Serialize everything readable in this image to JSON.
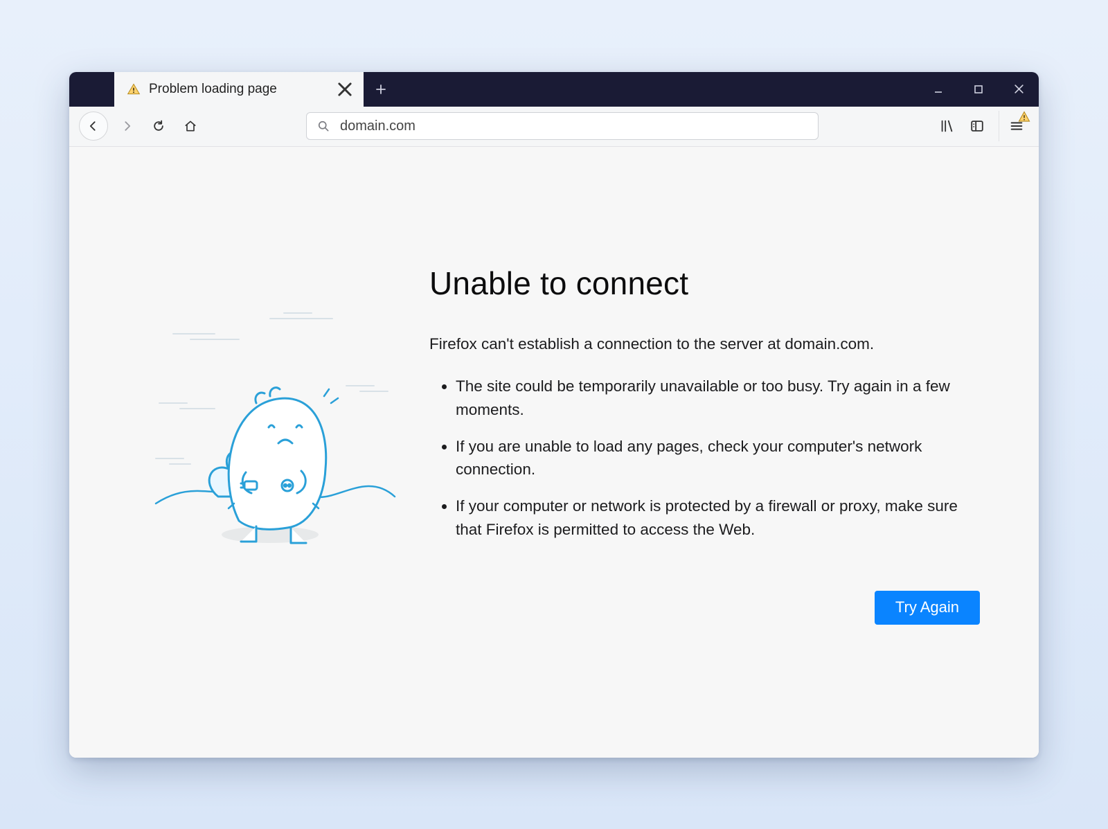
{
  "tab": {
    "title": "Problem loading page",
    "favicon": "warning-triangle-icon"
  },
  "addressBar": {
    "value": "domain.com",
    "searchIcon": "search-icon"
  },
  "nav": {
    "back": "back-icon",
    "forward": "forward-icon",
    "reload": "reload-icon",
    "home": "home-icon"
  },
  "toolbarRight": {
    "library": "library-icon",
    "sidebars": "sidebars-icon",
    "menu": "hamburger-icon",
    "menuBadge": "warning-triangle-icon"
  },
  "windowControls": {
    "newTab": "plus-icon",
    "minimize": "minimize-icon",
    "maximize": "maximize-icon",
    "close": "close-icon"
  },
  "errorPage": {
    "title": "Unable to connect",
    "description": "Firefox can't establish a connection to the server at domain.com.",
    "bullets": [
      "The site could be temporarily unavailable or too busy. Try again in a few moments.",
      "If you are unable to load any pages, check your computer's network connection.",
      "If your computer or network is protected by a firewall or proxy, make sure that Firefox is permitted to access the Web."
    ],
    "buttonLabel": "Try Again",
    "illustration": "firefox-connection-dino"
  },
  "colors": {
    "accent": "#0a84ff",
    "tabstrip": "#1a1b35",
    "pageBg": "#f7f7f7"
  }
}
